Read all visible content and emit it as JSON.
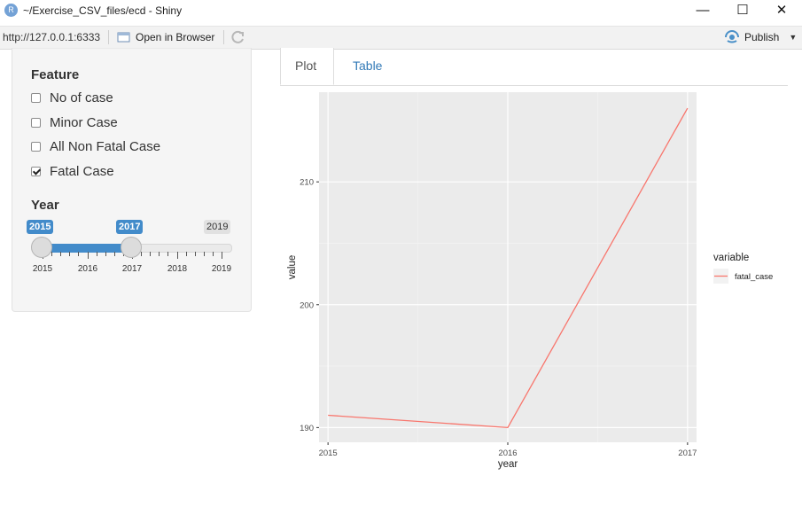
{
  "window": {
    "icon_letter": "R",
    "title": "~/Exercise_CSV_files/ecd - Shiny",
    "minimize_glyph": "—",
    "maximize_glyph": "☐",
    "close_glyph": "✕"
  },
  "toolbar": {
    "url": "http://127.0.0.1:6333",
    "open_in_browser": "Open in Browser",
    "publish": "Publish",
    "publish_caret": "▼"
  },
  "sidebar": {
    "feature_label": "Feature",
    "checkboxes": [
      {
        "label": "No of case",
        "checked": false
      },
      {
        "label": "Minor Case",
        "checked": false
      },
      {
        "label": "All Non Fatal Case",
        "checked": false
      },
      {
        "label": "Fatal Case",
        "checked": true
      }
    ],
    "year_label": "Year",
    "slider": {
      "min": 2015,
      "max": 2019,
      "from": 2015,
      "to": 2017,
      "from_label": "2015",
      "to_label": "2017",
      "max_label": "2019",
      "tick_labels": [
        "2015",
        "2016",
        "2017",
        "2018",
        "2019"
      ]
    }
  },
  "tabs": [
    {
      "label": "Plot",
      "active": true
    },
    {
      "label": "Table",
      "active": false
    }
  ],
  "chart_data": {
    "type": "line",
    "x": [
      2015,
      2016,
      2017
    ],
    "series": [
      {
        "name": "fatal_case",
        "values": [
          191,
          190,
          216
        ],
        "color": "#f8766d"
      }
    ],
    "xlabel": "year",
    "ylabel": "value",
    "x_tick_labels": [
      "2015",
      "2016",
      "2017"
    ],
    "y_tick_labels": [
      "190",
      "200",
      "210"
    ],
    "y_ticks": [
      190,
      200,
      210
    ],
    "xlim": [
      2014.95,
      2017.05
    ],
    "ylim": [
      188.8,
      217.3
    ],
    "legend_title": "variable",
    "legend_position": "right",
    "panel_background": "#ebebeb",
    "grid": true
  }
}
